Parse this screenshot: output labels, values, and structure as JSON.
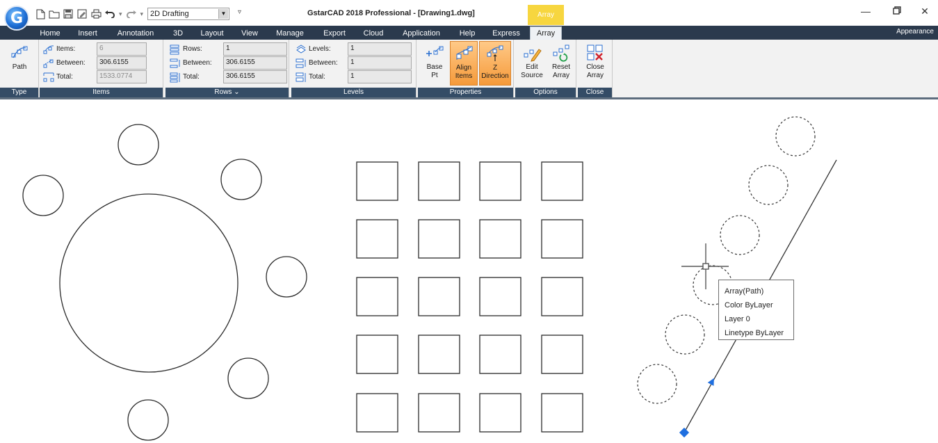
{
  "app": {
    "title": "GstarCAD 2018 Professional - [Drawing1.dwg]",
    "logo_letter": "G",
    "workspace": "2D Drafting",
    "context_tab_head": "Array"
  },
  "ribbon_tabs": [
    "Home",
    "Insert",
    "Annotation",
    "3D",
    "Layout",
    "View",
    "Manage",
    "Export",
    "Cloud",
    "Application",
    "Help",
    "Express",
    "Array"
  ],
  "active_tab": "Array",
  "appearance_label": "Appearance",
  "panels": {
    "type": {
      "label": "Type",
      "path_btn": "Path"
    },
    "items": {
      "label": "Items",
      "items_label": "Items:",
      "items_value": "6",
      "between_label": "Between:",
      "between_value": "306.6155",
      "total_label": "Total:",
      "total_value": "1533.0774"
    },
    "rows": {
      "label": "Rows",
      "rows_label": "Rows:",
      "rows_value": "1",
      "between_label": "Between:",
      "between_value": "306.6155",
      "total_label": "Total:",
      "total_value": "306.6155"
    },
    "levels": {
      "label": "Levels",
      "levels_label": "Levels:",
      "levels_value": "1",
      "between_label": "Between:",
      "between_value": "1",
      "total_label": "Total:",
      "total_value": "1"
    },
    "properties": {
      "label": "Properties",
      "base_pt_1": "Base",
      "base_pt_2": "Pt",
      "align_1": "Align",
      "align_2": "Items",
      "zdir_1": "Z",
      "zdir_2": "Direction"
    },
    "options": {
      "label": "Options",
      "edit_1": "Edit",
      "edit_2": "Source",
      "reset_1": "Reset",
      "reset_2": "Array"
    },
    "close": {
      "label": "Close",
      "close_1": "Close",
      "close_2": "Array"
    }
  },
  "tooltip": {
    "line1": "Array(Path)",
    "line2": "Color  ByLayer",
    "line3": "Layer  0",
    "line4": "Linetype  ByLayer"
  },
  "colors": {
    "tab_bar": "#2b3a4d",
    "panel_label": "#344c66",
    "context_yellow": "#f7d63f",
    "active_orange": "#f59a3a",
    "grip_blue": "#1f6fe0"
  }
}
